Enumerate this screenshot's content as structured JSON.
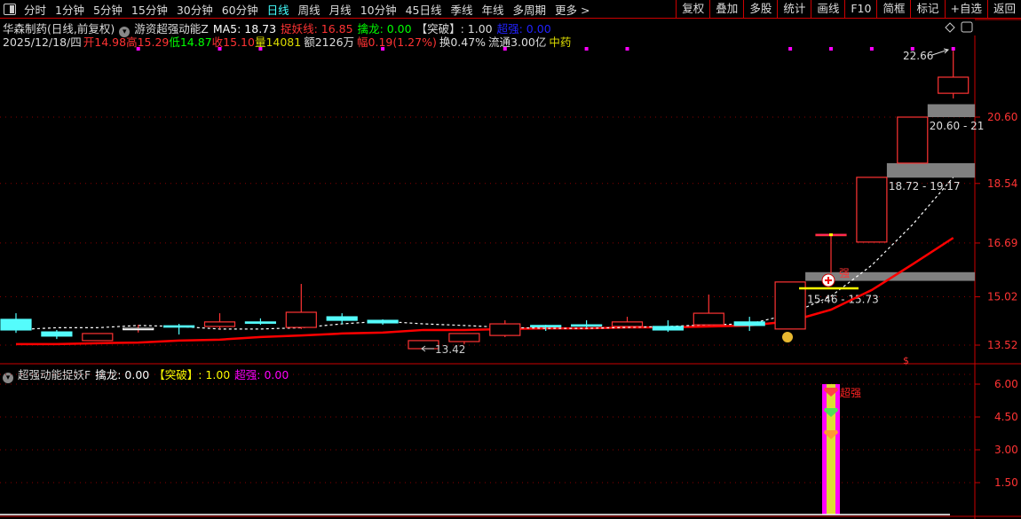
{
  "toolbar": {
    "left": [
      "分时",
      "1分钟",
      "5分钟",
      "15分钟",
      "30分钟",
      "60分钟",
      "日线",
      "周线",
      "月线",
      "10分钟",
      "45日线",
      "季线",
      "年线",
      "多周期",
      "更多 >"
    ],
    "active": "日线",
    "right": [
      "复权",
      "叠加",
      "多股",
      "统计",
      "画线",
      "F10",
      "简框",
      "标记",
      "+自选",
      "返回"
    ]
  },
  "header": {
    "stock": "华森制药(日线,前复权)",
    "indicator": "游资超强动能Z",
    "ma5": "MA5: 18.73",
    "zhuoyao": "捉妖线: 16.85",
    "qinlong": "擒龙: 0.00",
    "tupo": "【突破】: 1.00",
    "chaoqiang": "超强: 0.00"
  },
  "quote": {
    "date": "2025/12/18/四",
    "open": "开14.98",
    "high": "高15.29",
    "low": "低14.87",
    "close": "收15.10",
    "volume": "量14081",
    "amount": "额2126万",
    "change": "幅0.19(1.27%)",
    "turnover": "换0.47%",
    "float": "流通3.00亿",
    "sector": "中药"
  },
  "sub_header": {
    "indicator": "超强动能捉妖F",
    "qinlong": "擒龙: 0.00",
    "tupo": "【突破】: 1.00",
    "chaoqiang": "超强: 0.00"
  },
  "colors": {
    "up": "#ff3333",
    "down": "#54fcfc",
    "ma5": "#ffffff",
    "zhuoyao": "#ff0000",
    "zone": "#808080",
    "accent": "#ff00ff"
  },
  "chart_data": [
    {
      "type": "candlestick",
      "ylim": [
        13.2,
        23.3
      ],
      "yticks": [
        "20.60",
        "18.54",
        "16.69",
        "15.02",
        "13.52"
      ],
      "grid": true,
      "ohlc": [
        [
          14.32,
          14.51,
          13.9,
          13.99
        ],
        [
          13.93,
          13.99,
          13.71,
          13.8
        ],
        [
          13.66,
          13.88,
          13.66,
          13.88
        ],
        [
          14.04,
          14.15,
          13.91,
          14.04
        ],
        [
          14.12,
          14.18,
          13.85,
          14.1
        ],
        [
          14.1,
          14.51,
          14.02,
          14.24
        ],
        [
          14.24,
          14.35,
          14.15,
          14.21
        ],
        [
          14.07,
          15.42,
          14.02,
          14.54
        ],
        [
          14.4,
          14.51,
          14.18,
          14.29
        ],
        [
          14.29,
          14.32,
          14.15,
          14.21
        ],
        [
          13.41,
          13.66,
          13.41,
          13.66
        ],
        [
          13.63,
          13.88,
          13.55,
          13.88
        ],
        [
          13.82,
          14.29,
          13.77,
          14.18
        ],
        [
          14.13,
          14.15,
          13.96,
          14.1
        ],
        [
          14.15,
          14.29,
          14.07,
          14.13
        ],
        [
          14.1,
          14.4,
          14.1,
          14.24
        ],
        [
          14.1,
          14.29,
          13.93,
          13.99
        ],
        [
          14.15,
          15.09,
          14.15,
          14.51
        ],
        [
          14.24,
          14.4,
          13.96,
          14.13
        ],
        [
          14.02,
          15.48,
          14.02,
          15.48
        ],
        [
          16.96,
          16.99,
          15.75,
          16.96
        ],
        [
          16.72,
          18.73,
          16.72,
          18.73
        ],
        [
          19.17,
          20.6,
          19.17,
          20.6
        ],
        [
          21.34,
          22.66,
          21.18,
          21.84
        ]
      ],
      "ma5": [
        14.0,
        14.06,
        14.06,
        14.13,
        14.1,
        14.02,
        14.02,
        14.06,
        14.18,
        14.26,
        14.18,
        14.13,
        14.07,
        14.04,
        14.04,
        14.07,
        14.1,
        14.15,
        14.18,
        14.48,
        15.04,
        16.0,
        17.26,
        18.73
      ],
      "zhuoyao": [
        13.55,
        13.55,
        13.58,
        13.6,
        13.66,
        13.69,
        13.77,
        13.82,
        13.88,
        13.91,
        13.99,
        13.99,
        14.02,
        14.04,
        14.04,
        14.07,
        14.07,
        14.1,
        14.13,
        14.26,
        14.62,
        15.23,
        16.03,
        16.85
      ],
      "zones": [
        {
          "from_index": 19,
          "range": [
            15.46,
            15.73
          ],
          "label": "15.46 - 15.73"
        },
        {
          "from_index": 21,
          "range": [
            18.72,
            19.17
          ],
          "label": "18.72 - 19.17"
        },
        {
          "from_index": 22,
          "range": [
            20.6,
            21.0
          ],
          "label": "20.60 - 21"
        }
      ],
      "annotations": {
        "high_label": "22.66",
        "low_label": "13.42",
        "strong_label": "强",
        "signal_mark": "$"
      },
      "top_marker_indices": [
        3,
        5,
        6,
        9,
        12,
        14,
        15,
        19,
        20,
        21,
        22,
        23
      ]
    },
    {
      "type": "bar",
      "ylim": [
        0,
        6.5
      ],
      "yticks": [
        "6.00",
        "4.50",
        "3.00",
        "1.50"
      ],
      "bar_index": 20,
      "bar_value": 6.0,
      "label": "超强"
    }
  ]
}
